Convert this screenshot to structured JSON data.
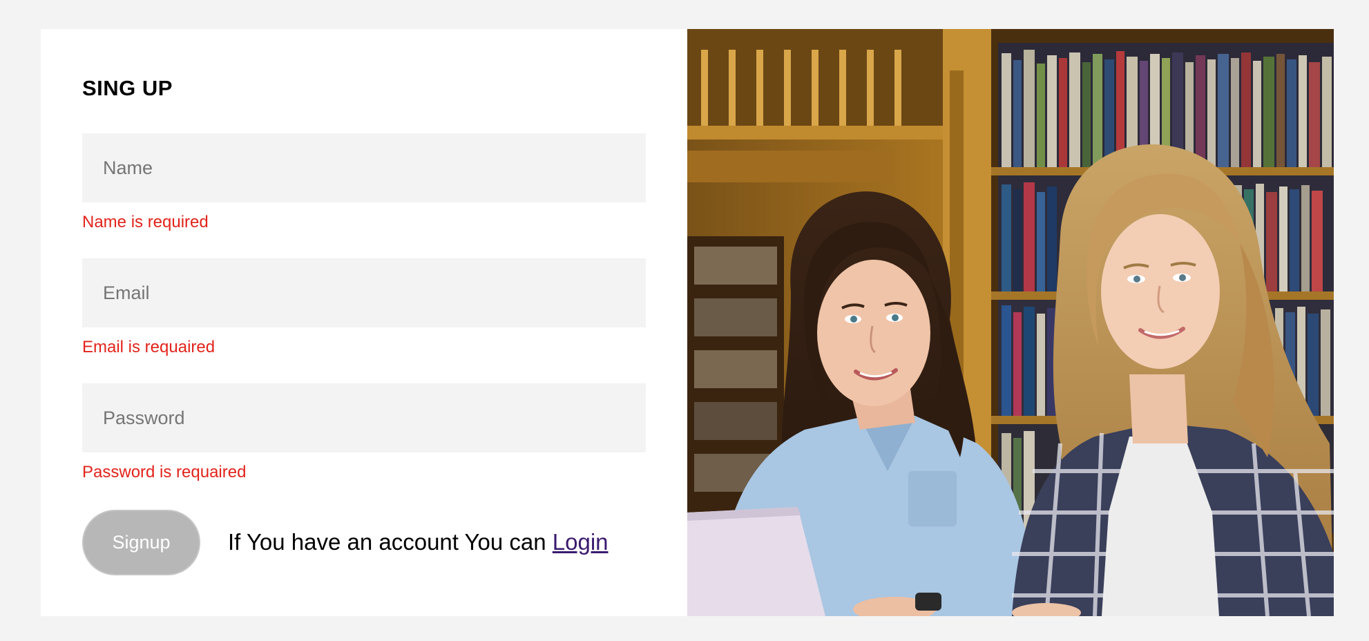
{
  "form": {
    "title": "SING UP",
    "name_placeholder": "Name",
    "name_error": "Name is required",
    "email_placeholder": "Email",
    "email_error": "Email is requaired",
    "password_placeholder": "Password",
    "password_error": "Password is requaired",
    "signup_label": "Signup",
    "account_prompt": "If You have an account You can",
    "login_label": "Login"
  },
  "colors": {
    "page_background": "#f3f3f3",
    "error": "#e2231a",
    "button_background": "#b7b7b7",
    "link": "#3b1a6e"
  },
  "hero_image": {
    "icon": "students-library-photo"
  }
}
